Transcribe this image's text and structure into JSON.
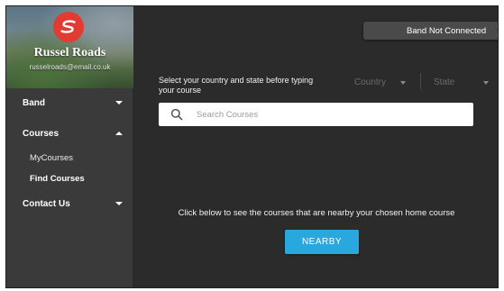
{
  "profile": {
    "name": "Russel Roads",
    "email": "russelroads@email.co.uk",
    "avatar_icon": "stylized-s-logo-icon",
    "avatar_color": "#e23b32"
  },
  "sidebar": {
    "items": [
      {
        "label": "Band",
        "expanded": false
      },
      {
        "label": "Courses",
        "expanded": true,
        "children": [
          {
            "label": "MyCourses",
            "active": false
          },
          {
            "label": "Find Courses",
            "active": true
          }
        ]
      },
      {
        "label": "Contact Us",
        "expanded": false
      }
    ]
  },
  "band_status": {
    "text": "Band Not Connected",
    "icon": "close-icon",
    "icon_color": "#e8322a"
  },
  "main": {
    "instruction": "Select your country and state before typing your course",
    "country_label": "Country",
    "state_label": "State",
    "search_placeholder": "Search Courses",
    "search_value": "",
    "nearby_text": "Click below to see the courses that are nearby your chosen home course",
    "nearby_button": "NEARBY"
  },
  "colors": {
    "accent": "#29a8e0",
    "background": "#2b2b2b",
    "sidebar": "#3a3a3a"
  }
}
